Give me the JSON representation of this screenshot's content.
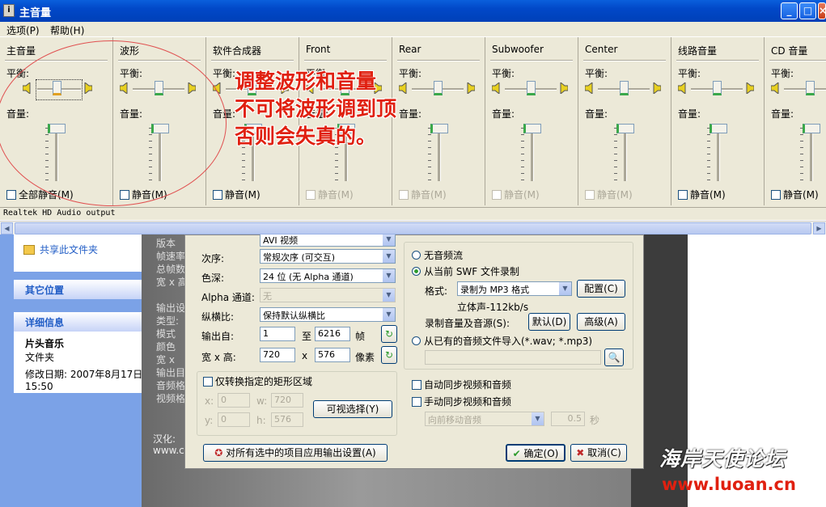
{
  "window": {
    "title": "主音量",
    "app_icon_label": "i",
    "minimize": "_",
    "maximize": "□",
    "close": "×"
  },
  "menu": {
    "options": "选项(P)",
    "help": "帮助(H)"
  },
  "labels": {
    "balance": "平衡:",
    "volume": "音量:"
  },
  "channels": [
    {
      "name": "主音量",
      "mute": "全部静音(M)",
      "enabled": true
    },
    {
      "name": "波形",
      "mute": "静音(M)",
      "enabled": true
    },
    {
      "name": "软件合成器",
      "mute": "静音(M)",
      "enabled": true
    },
    {
      "name": "Front",
      "mute": "静音(M)",
      "enabled": false
    },
    {
      "name": "Rear",
      "mute": "静音(M)",
      "enabled": false
    },
    {
      "name": "Subwoofer",
      "mute": "静音(M)",
      "enabled": false
    },
    {
      "name": "Center",
      "mute": "静音(M)",
      "enabled": false
    },
    {
      "name": "线路音量",
      "mute": "静音(M)",
      "enabled": true
    },
    {
      "name": "CD 音量",
      "mute": "静音(M)",
      "enabled": true
    }
  ],
  "status": "Realtek HD Audio output",
  "annotation": {
    "line1": "调整波形和音量",
    "line2": "不可将波形调到顶",
    "line3": "否则会失真的。"
  },
  "explorer": {
    "task_share": "共享此文件夹",
    "other_places": "其它位置",
    "details": "详细信息",
    "folder_name": "片头音乐",
    "folder_type": "文件夹",
    "modified": "修改日期: 2007年8月17日,",
    "modified_time": "15:50"
  },
  "bg_labels": {
    "l1": "版本",
    "l2": "帧速率",
    "l3": "总帧数",
    "l4": "宽 x 高",
    "l5": "输出设",
    "l6": "类型:",
    "l7": "模式",
    "l8": "颜色",
    "l9": "宽 x",
    "l10": "输出目",
    "l11": "音频格",
    "l12": "视频格",
    "l13": "汉化:",
    "l14": "www.co"
  },
  "dialog": {
    "order_label": "次序:",
    "order_value": "常规次序 (可交互)",
    "depth_label": "色深:",
    "depth_value": "24 位 (无 Alpha 通道)",
    "alpha_label": "Alpha 通道:",
    "alpha_value": "无",
    "aspect_label": "纵横比:",
    "aspect_value": "保持默认纵横比",
    "output_label": "输出自:",
    "from_frame": "1",
    "to": "至",
    "to_frame": "6216",
    "frames": "帧",
    "wh_label": "宽 x 高:",
    "width": "720",
    "x": "x",
    "height": "576",
    "pixels": "像素",
    "rect_check": "仅转换指定的矩形区域",
    "rx_label": "x:",
    "rx": "0",
    "rw_label": "w:",
    "rw": "720",
    "ry_label": "y:",
    "ry": "0",
    "rh_label": "h:",
    "rh": "576",
    "visual_select": "可视选择(Y)",
    "no_audio": "无音频流",
    "record_swf": "从当前 SWF 文件录制",
    "format_label": "格式:",
    "format_value": "录制为 MP3 格式",
    "config": "配置(C)",
    "stereo": "立体声-112kb/s",
    "record_volume": "录制音量及音源(S):",
    "default": "默认(D)",
    "advanced": "高级(A)",
    "import_audio": "从已有的音频文件导入(*.wav; *.mp3)",
    "auto_sync": "自动同步视频和音频",
    "manual_sync": "手动同步视频和音频",
    "move_audio": "向前移动音频",
    "seconds_value": "0.5",
    "seconds": "秒",
    "apply_all": "对所有选中的项目应用输出设置(A)",
    "ok": "确定(O)",
    "cancel": "取消(C)",
    "output_type_value": "AVI 视频"
  },
  "watermark": {
    "text": "海岸天使论坛",
    "url": "www.luoan.cn"
  }
}
